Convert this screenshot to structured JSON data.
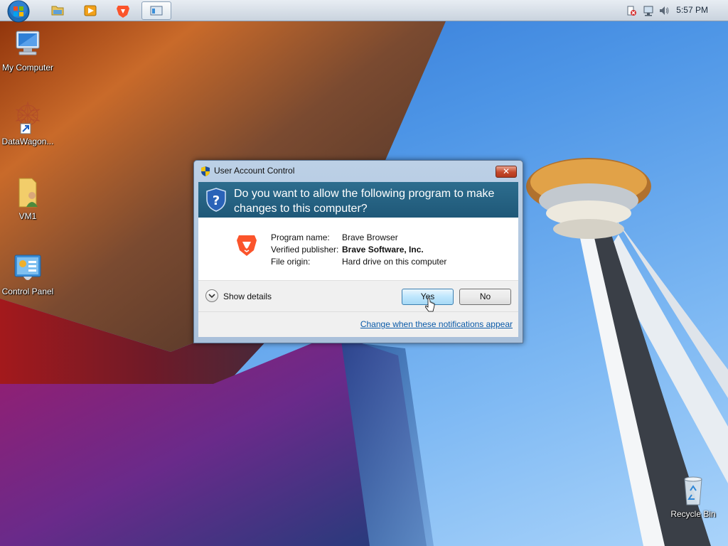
{
  "taskbar": {
    "pinned": [
      {
        "name": "windows-explorer",
        "icon": "folder-icon"
      },
      {
        "name": "media-player",
        "icon": "media-player-icon"
      },
      {
        "name": "brave-browser",
        "icon": "brave-lion-icon"
      },
      {
        "name": "active-window",
        "icon": "window-icon"
      }
    ],
    "tray": {
      "clock": "5:57 PM"
    }
  },
  "desktop": {
    "icons": [
      {
        "label": "My Computer",
        "icon": "computer-icon"
      },
      {
        "label": "DataWagon...",
        "icon": "shortcut-icon"
      },
      {
        "label": "VM1",
        "icon": "user-folder-icon"
      },
      {
        "label": "Control Panel",
        "icon": "control-panel-icon"
      },
      {
        "label": "Recycle Bin",
        "icon": "recycle-bin-icon"
      }
    ]
  },
  "uac": {
    "title": "User Account Control",
    "close_label": "✕",
    "question": "Do you want to allow the following program to make changes to this computer?",
    "program_name_label": "Program name:",
    "program_name": "Brave Browser",
    "publisher_label": "Verified publisher:",
    "publisher": "Brave Software, Inc.",
    "origin_label": "File origin:",
    "origin": "Hard drive on this computer",
    "show_details": "Show details",
    "yes": "Yes",
    "no": "No",
    "notifications_link": "Change when these notifications appear"
  },
  "colors": {
    "uac_header": "#1f5878",
    "link": "#0a5aa8",
    "brave_orange": "#fb542b"
  }
}
